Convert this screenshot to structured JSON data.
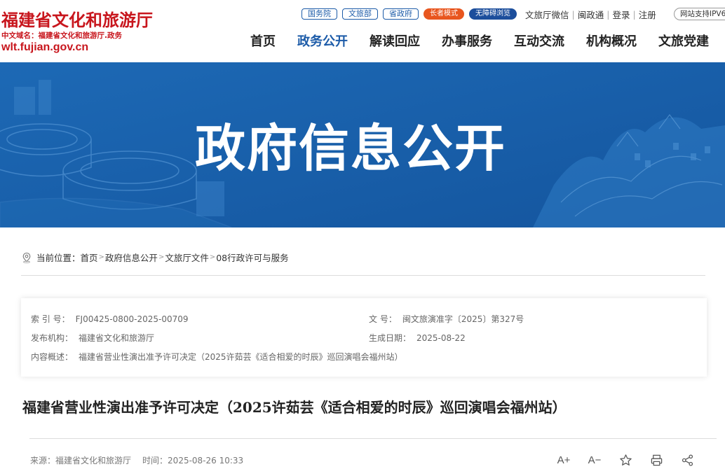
{
  "site": {
    "title": "福建省文化和旅游厅",
    "cn_domain": "中文域名：福建省文化和旅游厅.政务",
    "domain": "wlt.fujian.gov.cn"
  },
  "topbar": {
    "links": [
      "国务院",
      "文旅部",
      "省政府"
    ],
    "elder_mode": "长者模式",
    "accessibility": "无障碍浏览",
    "wechat": "文旅厅微信",
    "minzhengtong": "闽政通",
    "login": "登录",
    "register": "注册",
    "ipv6": "网站支持IPV6"
  },
  "nav": {
    "items": [
      {
        "label": "首页"
      },
      {
        "label": "政务公开"
      },
      {
        "label": "解读回应"
      },
      {
        "label": "办事服务"
      },
      {
        "label": "互动交流"
      },
      {
        "label": "机构概况"
      },
      {
        "label": "文旅党建"
      }
    ],
    "active": "政务公开"
  },
  "banner": {
    "title": "政府信息公开"
  },
  "breadcrumb": {
    "prefix": "当前位置：",
    "items": [
      "首页",
      "政府信息公开",
      "文旅厅文件",
      "08行政许可与服务"
    ]
  },
  "meta": {
    "index_label": "索 引 号：",
    "index_value": "FJ00425-0800-2025-00709",
    "docno_label": "文 号：",
    "docno_value": "闽文旅演准字〔2025〕第327号",
    "publisher_label": "发布机构：",
    "publisher_value": "福建省文化和旅游厅",
    "date_label": "生成日期：",
    "date_value": "2025-08-22",
    "summary_label": "内容概述：",
    "summary_value": "福建省营业性演出准予许可决定（2025许茹芸《适合相爱的时辰》巡回演唱会福州站）"
  },
  "article": {
    "title": "福建省营业性演出准予许可决定（2025许茹芸《适合相爱的时辰》巡回演唱会福州站）",
    "source_label": "来源：",
    "source_value": "福建省文化和旅游厅",
    "time_label": "时间：",
    "time_value": "2025-08-26 10:33"
  },
  "tools": {
    "font_up": "A+",
    "font_down": "A−"
  },
  "colors": {
    "brand_red": "#c8161d",
    "brand_blue": "#1c5ba8",
    "banner_blue": "#1a62ad",
    "elder_orange": "#e8561f"
  }
}
